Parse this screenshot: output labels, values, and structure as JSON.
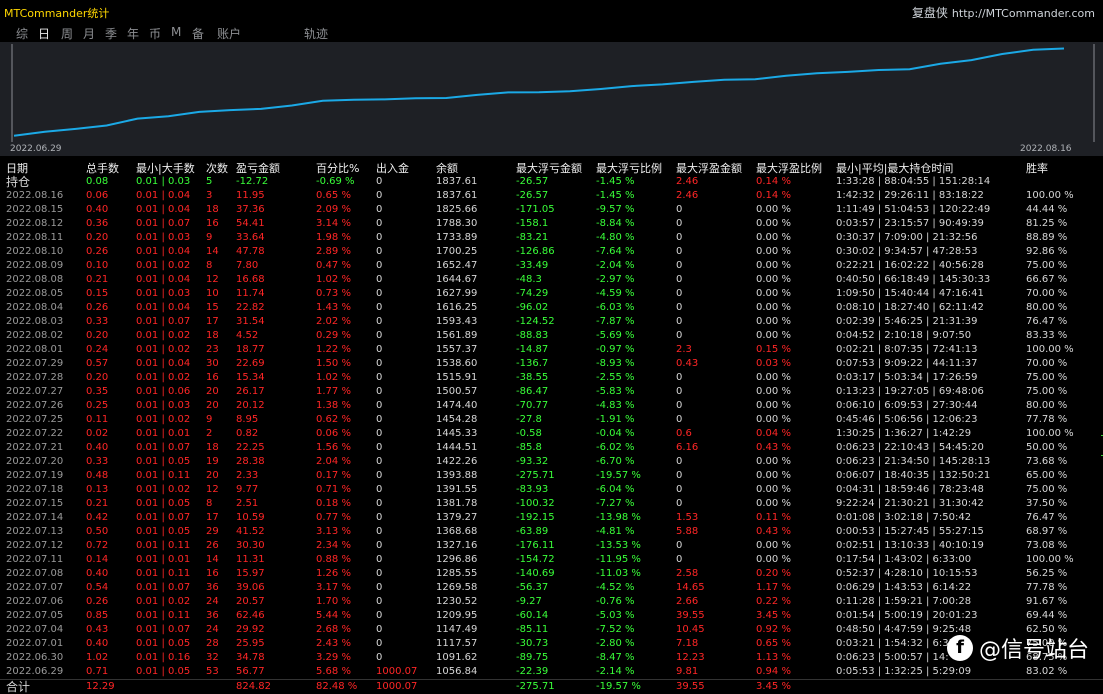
{
  "app": {
    "title": "MTCommander统计",
    "brand_cn": "复盘侠",
    "brand_url": "http://MTCommander.com"
  },
  "nav": [
    "综",
    "日",
    "周",
    "月",
    "季",
    "年",
    "币",
    "M",
    "备",
    "账户",
    "轨迹"
  ],
  "chart": {
    "start_label": "2022.06.29",
    "end_label": "2022.08.16",
    "line_color": "#1ba9e6",
    "points": [
      1056.84,
      1091.62,
      1117.57,
      1147.49,
      1209.95,
      1230.52,
      1269.58,
      1285.55,
      1296.86,
      1327.16,
      1368.68,
      1379.27,
      1381.78,
      1391.55,
      1393.88,
      1422.26,
      1444.51,
      1445.33,
      1454.28,
      1474.4,
      1500.57,
      1515.91,
      1538.6,
      1557.37,
      1561.89,
      1593.43,
      1616.25,
      1627.99,
      1644.67,
      1652.47,
      1700.25,
      1733.89,
      1788.3,
      1825.66,
      1837.61
    ]
  },
  "columns": [
    "日期",
    "总手数",
    "最小|大手数",
    "次数",
    "盈亏金额",
    "百分比%",
    "出入金",
    "余额",
    "最大浮亏金额",
    "最大浮亏比例",
    "最大浮盈金额",
    "最大浮盈比例",
    "最小|平均|最大持仓时间",
    "胜率"
  ],
  "holding": [
    "持仓",
    "0.08",
    "0.01 | 0.03",
    "5",
    "-12.72",
    "-0.69 %",
    "0",
    "1837.61",
    "-26.57",
    "-1.45 %",
    "2.46",
    "0.14 %",
    "1:33:28 | 88:04:55 | 151:28:14",
    ""
  ],
  "rows": [
    [
      "2022.08.16",
      "0.06",
      "0.01 | 0.04",
      "3",
      "11.95",
      "0.65 %",
      "0",
      "1837.61",
      "-26.57",
      "-1.45 %",
      "2.46",
      "0.14 %",
      "1:42:32 | 29:26:11 | 83:18:22",
      "100.00 %"
    ],
    [
      "2022.08.15",
      "0.40",
      "0.01 | 0.04",
      "18",
      "37.36",
      "2.09 %",
      "0",
      "1825.66",
      "-171.05",
      "-9.57 %",
      "0",
      "0.00 %",
      "1:11:49 | 51:04:53 | 120:22:49",
      "44.44 %"
    ],
    [
      "2022.08.12",
      "0.36",
      "0.01 | 0.07",
      "16",
      "54.41",
      "3.14 %",
      "0",
      "1788.30",
      "-158.1",
      "-8.84 %",
      "0",
      "0.00 %",
      "0:03:57 | 23:15:57 | 90:49:39",
      "81.25 %"
    ],
    [
      "2022.08.11",
      "0.20",
      "0.01 | 0.03",
      "9",
      "33.64",
      "1.98 %",
      "0",
      "1733.89",
      "-83.21",
      "-4.80 %",
      "0",
      "0.00 %",
      "0:30:37 | 7:09:00 | 21:32:56",
      "88.89 %"
    ],
    [
      "2022.08.10",
      "0.26",
      "0.01 | 0.04",
      "14",
      "47.78",
      "2.89 %",
      "0",
      "1700.25",
      "-126.86",
      "-7.64 %",
      "0",
      "0.00 %",
      "0:30:02 | 9:34:57 | 47:28:53",
      "92.86 %"
    ],
    [
      "2022.08.09",
      "0.10",
      "0.01 | 0.02",
      "8",
      "7.80",
      "0.47 %",
      "0",
      "1652.47",
      "-33.49",
      "-2.04 %",
      "0",
      "0.00 %",
      "0:22:21 | 16:02:22 | 40:56:28",
      "75.00 %"
    ],
    [
      "2022.08.08",
      "0.21",
      "0.01 | 0.04",
      "12",
      "16.68",
      "1.02 %",
      "0",
      "1644.67",
      "-48.3",
      "-2.97 %",
      "0",
      "0.00 %",
      "0:40:50 | 66:18:49 | 145:30:33",
      "66.67 %"
    ],
    [
      "2022.08.05",
      "0.15",
      "0.01 | 0.03",
      "10",
      "11.74",
      "0.73 %",
      "0",
      "1627.99",
      "-74.29",
      "-4.59 %",
      "0",
      "0.00 %",
      "1:09:50 | 15:40:44 | 47:16:41",
      "70.00 %"
    ],
    [
      "2022.08.04",
      "0.26",
      "0.01 | 0.04",
      "15",
      "22.82",
      "1.43 %",
      "0",
      "1616.25",
      "-96.02",
      "-6.03 %",
      "0",
      "0.00 %",
      "0:08:10 | 18:27:40 | 62:11:42",
      "80.00 %"
    ],
    [
      "2022.08.03",
      "0.33",
      "0.01 | 0.07",
      "17",
      "31.54",
      "2.02 %",
      "0",
      "1593.43",
      "-124.52",
      "-7.87 %",
      "0",
      "0.00 %",
      "0:02:39 | 5:46:25 | 21:31:39",
      "76.47 %"
    ],
    [
      "2022.08.02",
      "0.20",
      "0.01 | 0.02",
      "18",
      "4.52",
      "0.29 %",
      "0",
      "1561.89",
      "-88.83",
      "-5.69 %",
      "0",
      "0.00 %",
      "0:04:52 | 2:10:18 | 9:07:50",
      "83.33 %"
    ],
    [
      "2022.08.01",
      "0.24",
      "0.01 | 0.02",
      "23",
      "18.77",
      "1.22 %",
      "0",
      "1557.37",
      "-14.87",
      "-0.97 %",
      "2.3",
      "0.15 %",
      "0:02:21 | 8:07:35 | 72:41:13",
      "100.00 %"
    ],
    [
      "2022.07.29",
      "0.57",
      "0.01 | 0.04",
      "30",
      "22.69",
      "1.50 %",
      "0",
      "1538.60",
      "-136.7",
      "-8.93 %",
      "0.43",
      "0.03 %",
      "0:07:53 | 9:09:22 | 44:11:37",
      "70.00 %"
    ],
    [
      "2022.07.28",
      "0.20",
      "0.01 | 0.02",
      "16",
      "15.34",
      "1.02 %",
      "0",
      "1515.91",
      "-38.55",
      "-2.55 %",
      "0",
      "0.00 %",
      "0:03:17 | 5:03:34 | 17:26:59",
      "75.00 %"
    ],
    [
      "2022.07.27",
      "0.35",
      "0.01 | 0.06",
      "20",
      "26.17",
      "1.77 %",
      "0",
      "1500.57",
      "-86.47",
      "-5.83 %",
      "0",
      "0.00 %",
      "0:13:23 | 19:27:05 | 69:48:06",
      "75.00 %"
    ],
    [
      "2022.07.26",
      "0.25",
      "0.01 | 0.03",
      "20",
      "20.12",
      "1.38 %",
      "0",
      "1474.40",
      "-70.77",
      "-4.83 %",
      "0",
      "0.00 %",
      "0:06:10 | 6:09:53 | 27:30:44",
      "80.00 %"
    ],
    [
      "2022.07.25",
      "0.11",
      "0.01 | 0.02",
      "9",
      "8.95",
      "0.62 %",
      "0",
      "1454.28",
      "-27.8",
      "-1.91 %",
      "0",
      "0.00 %",
      "0:45:46 | 5:06:56 | 12:06:23",
      "77.78 %"
    ],
    [
      "2022.07.22",
      "0.02",
      "0.01 | 0.01",
      "2",
      "0.82",
      "0.06 %",
      "0",
      "1445.33",
      "-0.58",
      "-0.04 %",
      "0.6",
      "0.04 %",
      "1:30:25 | 1:36:27 | 1:42:29",
      "100.00 %"
    ],
    [
      "2022.07.21",
      "0.40",
      "0.01 | 0.07",
      "18",
      "22.25",
      "1.56 %",
      "0",
      "1444.51",
      "-85.8",
      "-6.02 %",
      "6.16",
      "0.43 %",
      "0:06:23 | 22:10:43 | 54:45:20",
      "50.00 %"
    ],
    [
      "2022.07.20",
      "0.33",
      "0.01 | 0.05",
      "19",
      "28.38",
      "2.04 %",
      "0",
      "1422.26",
      "-93.32",
      "-6.70 %",
      "0",
      "0.00 %",
      "0:06:23 | 21:34:50 | 145:28:13",
      "73.68 %"
    ],
    [
      "2022.07.19",
      "0.48",
      "0.01 | 0.11",
      "20",
      "2.33",
      "0.17 %",
      "0",
      "1393.88",
      "-275.71",
      "-19.57 %",
      "0",
      "0.00 %",
      "0:06:07 | 18:40:35 | 132:50:21",
      "65.00 %"
    ],
    [
      "2022.07.18",
      "0.13",
      "0.01 | 0.02",
      "12",
      "9.77",
      "0.71 %",
      "0",
      "1391.55",
      "-83.93",
      "-6.04 %",
      "0",
      "0.00 %",
      "0:04:31 | 18:59:46 | 78:23:48",
      "75.00 %"
    ],
    [
      "2022.07.15",
      "0.21",
      "0.01 | 0.05",
      "8",
      "2.51",
      "0.18 %",
      "0",
      "1381.78",
      "-100.32",
      "-7.27 %",
      "0",
      "0.00 %",
      "9:22:24 | 21:30:21 | 31:30:42",
      "37.50 %"
    ],
    [
      "2022.07.14",
      "0.42",
      "0.01 | 0.07",
      "17",
      "10.59",
      "0.77 %",
      "0",
      "1379.27",
      "-192.15",
      "-13.98 %",
      "1.53",
      "0.11 %",
      "0:01:08 | 3:02:18 | 7:50:42",
      "76.47 %"
    ],
    [
      "2022.07.13",
      "0.50",
      "0.01 | 0.05",
      "29",
      "41.52",
      "3.13 %",
      "0",
      "1368.68",
      "-63.89",
      "-4.81 %",
      "5.88",
      "0.43 %",
      "0:00:53 | 15:27:45 | 55:27:15",
      "68.97 %"
    ],
    [
      "2022.07.12",
      "0.72",
      "0.01 | 0.11",
      "26",
      "30.30",
      "2.34 %",
      "0",
      "1327.16",
      "-176.11",
      "-13.53 %",
      "0",
      "0.00 %",
      "0:02:51 | 13:10:33 | 40:10:19",
      "73.08 %"
    ],
    [
      "2022.07.11",
      "0.14",
      "0.01 | 0.01",
      "14",
      "11.31",
      "0.88 %",
      "0",
      "1296.86",
      "-154.72",
      "-11.95 %",
      "0",
      "0.00 %",
      "0:17:54 | 1:43:02 | 6:33:00",
      "100.00 %"
    ],
    [
      "2022.07.08",
      "0.40",
      "0.01 | 0.11",
      "16",
      "15.97",
      "1.26 %",
      "0",
      "1285.55",
      "-140.69",
      "-11.03 %",
      "2.58",
      "0.20 %",
      "0:52:37 | 4:28:10 | 10:15:53",
      "56.25 %"
    ],
    [
      "2022.07.07",
      "0.54",
      "0.01 | 0.07",
      "36",
      "39.06",
      "3.17 %",
      "0",
      "1269.58",
      "-56.37",
      "-4.52 %",
      "14.65",
      "1.17 %",
      "0:06:29 | 1:43:53 | 6:14:22",
      "77.78 %"
    ],
    [
      "2022.07.06",
      "0.26",
      "0.01 | 0.02",
      "24",
      "20.57",
      "1.70 %",
      "0",
      "1230.52",
      "-9.27",
      "-0.76 %",
      "2.66",
      "0.22 %",
      "0:11:28 | 1:59:21 | 7:00:28",
      "91.67 %"
    ],
    [
      "2022.07.05",
      "0.85",
      "0.01 | 0.11",
      "36",
      "62.46",
      "5.44 %",
      "0",
      "1209.95",
      "-60.14",
      "-5.03 %",
      "39.55",
      "3.45 %",
      "0:01:54 | 5:00:19 | 20:01:23",
      "69.44 %"
    ],
    [
      "2022.07.04",
      "0.43",
      "0.01 | 0.07",
      "24",
      "29.92",
      "2.68 %",
      "0",
      "1147.49",
      "-85.11",
      "-7.52 %",
      "10.45",
      "0.92 %",
      "0:48:50 | 4:47:59 | 9:25:48",
      "62.50 %"
    ],
    [
      "2022.07.01",
      "0.40",
      "0.01 | 0.05",
      "28",
      "25.95",
      "2.43 %",
      "0",
      "1117.57",
      "-30.73",
      "-2.80 %",
      "7.18",
      "0.65 %",
      "0:03:21 | 1:54:32 | 6:35:",
      "75.00 %"
    ],
    [
      "2022.06.30",
      "1.02",
      "0.01 | 0.16",
      "32",
      "34.78",
      "3.29 %",
      "0",
      "1091.62",
      "-89.75",
      "-8.47 %",
      "12.23",
      "1.13 %",
      "0:06:23 | 5:00:57 | 14:",
      "68.75 %"
    ],
    [
      "2022.06.29",
      "0.71",
      "0.01 | 0.05",
      "53",
      "56.77",
      "5.68 %",
      "1000.07",
      "1056.84",
      "-22.39",
      "-2.14 %",
      "9.81",
      "0.94 %",
      "0:05:53 | 1:32:25 | 5:29:09",
      "83.02 %"
    ]
  ],
  "total": [
    "合计",
    "12.29",
    "",
    "",
    "824.82",
    "82.48 %",
    "1000.07",
    "",
    "-275.71",
    "-19.57 %",
    "39.55",
    "3.45 %",
    "",
    ""
  ],
  "watermark": {
    "icon": "f",
    "text": "@信号站台"
  }
}
